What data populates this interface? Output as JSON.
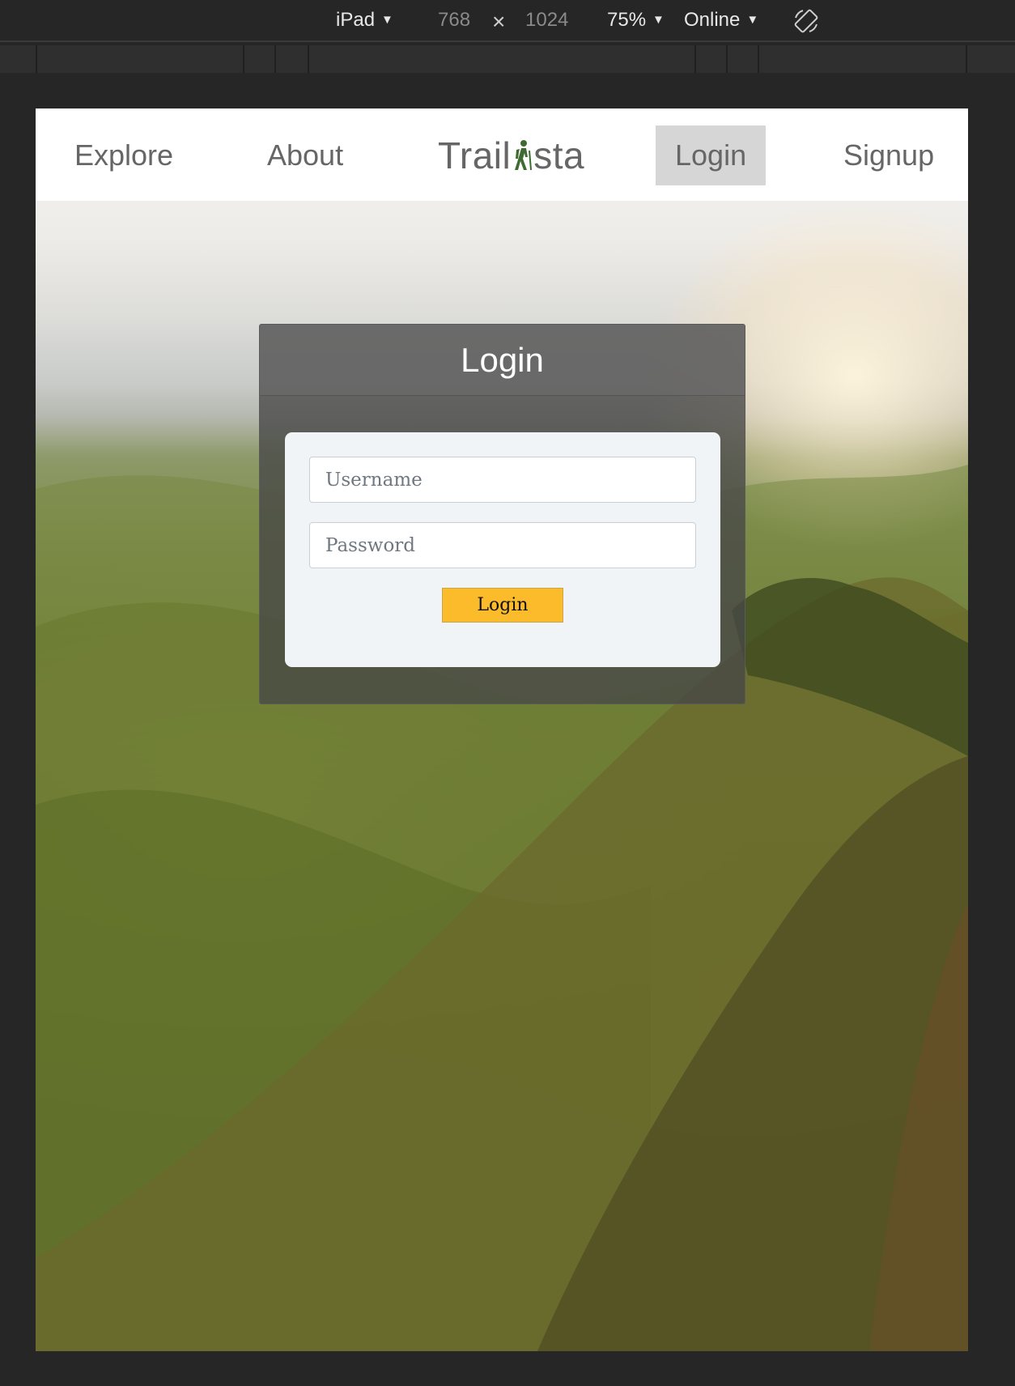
{
  "devtools": {
    "device": "iPad",
    "width": "768",
    "times": "×",
    "height": "1024",
    "zoom": "75%",
    "network": "Online",
    "caret": "▼"
  },
  "nav": {
    "explore": "Explore",
    "about": "About",
    "logo_left": "Trail",
    "logo_right": "sta",
    "login": "Login",
    "signup": "Signup"
  },
  "login_panel": {
    "title": "Login",
    "username_placeholder": "Username",
    "password_placeholder": "Password",
    "submit_label": "Login"
  },
  "colors": {
    "accent_button": "#fbbb2b",
    "logo_icon": "#3f6b32",
    "active_nav": "#d6d6d6"
  },
  "icons": {
    "logo": "hiker-icon",
    "rotate": "rotate-device-icon"
  }
}
